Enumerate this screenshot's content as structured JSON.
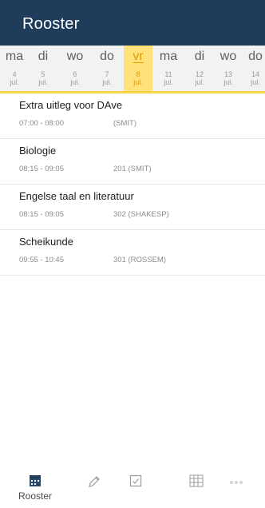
{
  "header": {
    "title": "Rooster"
  },
  "dates": [
    {
      "day": "ma",
      "num": "4",
      "month": "jul."
    },
    {
      "day": "di",
      "num": "5",
      "month": "jul."
    },
    {
      "day": "wo",
      "num": "6",
      "month": "jul."
    },
    {
      "day": "do",
      "num": "7",
      "month": "jul."
    },
    {
      "day": "vr",
      "num": "8",
      "month": "jul."
    },
    {
      "day": "ma",
      "num": "11",
      "month": "jul."
    },
    {
      "day": "di",
      "num": "12",
      "month": "jul."
    },
    {
      "day": "wo",
      "num": "13",
      "month": "jul."
    },
    {
      "day": "do",
      "num": "14",
      "month": "jul."
    }
  ],
  "selected_date_index": 4,
  "lessons": [
    {
      "subject": "Extra uitleg voor DAve",
      "time": "07:00 - 08:00",
      "room": "(SMIT)"
    },
    {
      "subject": "Biologie",
      "time": "08:15 - 09:05",
      "room": "201 (SMIT)"
    },
    {
      "subject": "Engelse taal en literatuur",
      "time": "08:15 - 09:05",
      "room": "302 (SHAKESP)"
    },
    {
      "subject": "Scheikunde",
      "time": "09:55 - 10:45",
      "room": "301 (ROSSEM)"
    }
  ],
  "bottom_nav": {
    "items": [
      {
        "label": "Rooster",
        "icon": "calendar-icon"
      },
      {
        "label": "",
        "icon": "pencil-icon"
      },
      {
        "label": "",
        "icon": "checkbox-icon"
      },
      {
        "label": "",
        "icon": "grid-icon"
      },
      {
        "label": "",
        "icon": "more-icon"
      }
    ]
  },
  "colors": {
    "header_bg": "#1f3d5a",
    "selected_bg": "#ffe27a",
    "selected_text": "#e39b00",
    "strip_bg": "#f2f2f2"
  }
}
